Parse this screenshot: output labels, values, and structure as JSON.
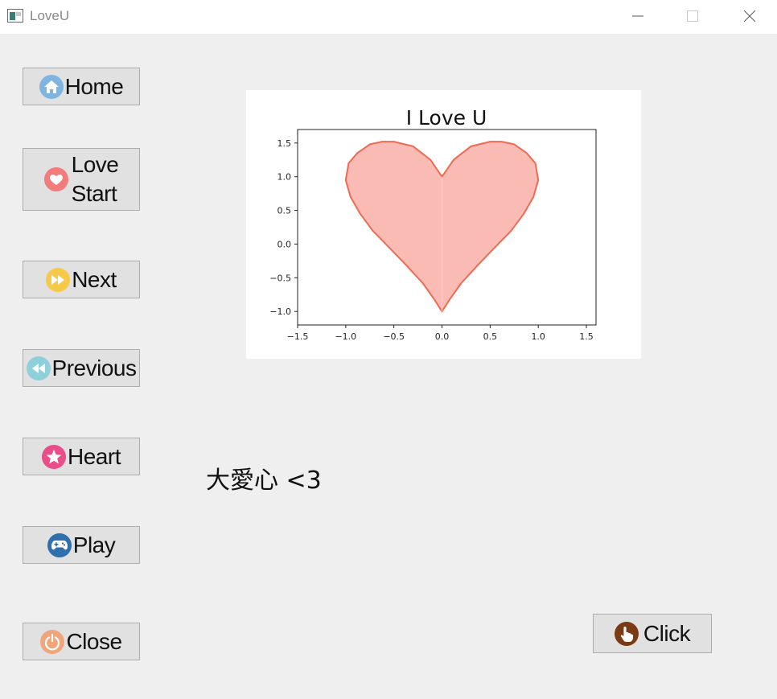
{
  "window": {
    "title": "LoveU"
  },
  "sidebar": {
    "buttons": [
      {
        "label": "Home",
        "icon": "home-icon",
        "color": "#7fb3e0"
      },
      {
        "label_line1": "Love",
        "label_line2": "Start",
        "icon": "heart-icon",
        "color": "#f27b7b"
      },
      {
        "label": "Next",
        "icon": "fast-forward-icon",
        "color": "#f7c948"
      },
      {
        "label": "Previous",
        "icon": "rewind-icon",
        "color": "#8ecfd9"
      },
      {
        "label": "Heart",
        "icon": "star-icon",
        "color": "#e94d8a"
      },
      {
        "label": "Play",
        "icon": "gamepad-icon",
        "color": "#2f6fab"
      },
      {
        "label": "Close",
        "icon": "power-icon",
        "color": "#f0a67a"
      }
    ]
  },
  "caption": "大愛心 <3",
  "click_button": {
    "label": "Click",
    "icon": "hand-pointer-icon",
    "color": "#7a3a14"
  },
  "chart_data": {
    "type": "area",
    "title": "I Love U",
    "xlabel": "",
    "ylabel": "",
    "xlim": [
      -1.5,
      1.6
    ],
    "ylim": [
      -1.2,
      1.7
    ],
    "xticks": [
      "−1.5",
      "−1.0",
      "−0.5",
      "0.0",
      "0.5",
      "1.0",
      "1.5"
    ],
    "yticks": [
      "−1.0",
      "−0.5",
      "0.0",
      "0.5",
      "1.0",
      "1.5"
    ],
    "fill_color": "#fbbbb5",
    "line_color": "#ef6a52",
    "series": [
      {
        "x": [
          0.0,
          0.12,
          0.3,
          0.5,
          0.62,
          0.75,
          0.88,
          0.97,
          1.0,
          0.95,
          0.85,
          0.72,
          0.55,
          0.38,
          0.2,
          0.08,
          0.0,
          -0.08,
          -0.2,
          -0.38,
          -0.55,
          -0.72,
          -0.85,
          -0.95,
          -1.0,
          -0.97,
          -0.88,
          -0.75,
          -0.62,
          -0.5,
          -0.3,
          -0.12,
          0.0
        ],
        "y": [
          1.0,
          1.25,
          1.45,
          1.52,
          1.52,
          1.48,
          1.35,
          1.2,
          0.95,
          0.7,
          0.45,
          0.2,
          -0.05,
          -0.3,
          -0.58,
          -0.82,
          -1.0,
          -0.82,
          -0.58,
          -0.3,
          -0.05,
          0.2,
          0.45,
          0.7,
          0.95,
          1.2,
          1.35,
          1.48,
          1.52,
          1.52,
          1.45,
          1.25,
          1.0
        ]
      }
    ]
  }
}
